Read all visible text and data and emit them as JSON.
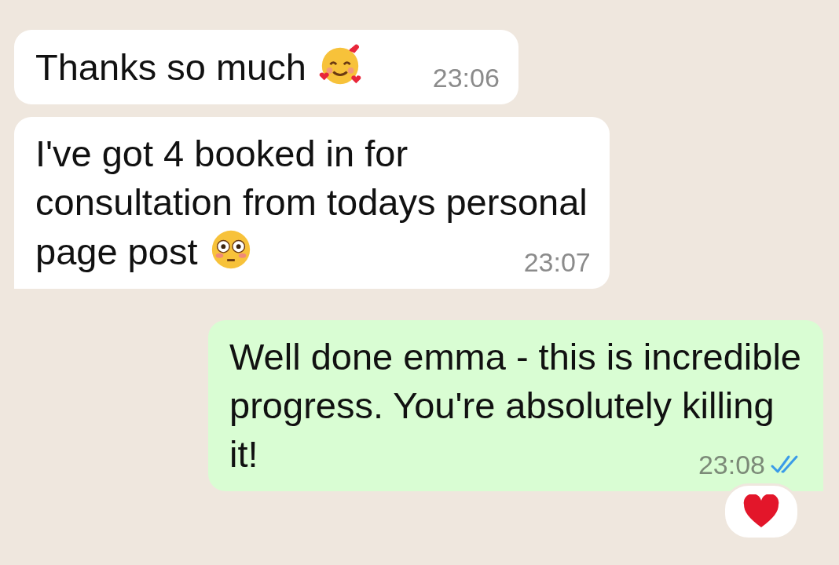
{
  "messages": [
    {
      "kind": "incoming",
      "lines": [
        "Thanks so much"
      ],
      "emoji": {
        "kind": "smiling_face_with_hearts"
      },
      "time": "23:06",
      "tail": false
    },
    {
      "kind": "incoming",
      "lines": [
        "I've got 4 booked in for",
        "consultation from todays personal",
        "page post"
      ],
      "emoji": {
        "kind": "flushed_face"
      },
      "time": "23:07",
      "tail": true
    },
    {
      "kind": "outgoing",
      "lines": [
        "Well done emma - this is incredible",
        "progress. You're absolutely killing",
        "it!"
      ],
      "time": "23:08",
      "tail": true,
      "read": true,
      "reaction": {
        "kind": "heart"
      }
    }
  ]
}
